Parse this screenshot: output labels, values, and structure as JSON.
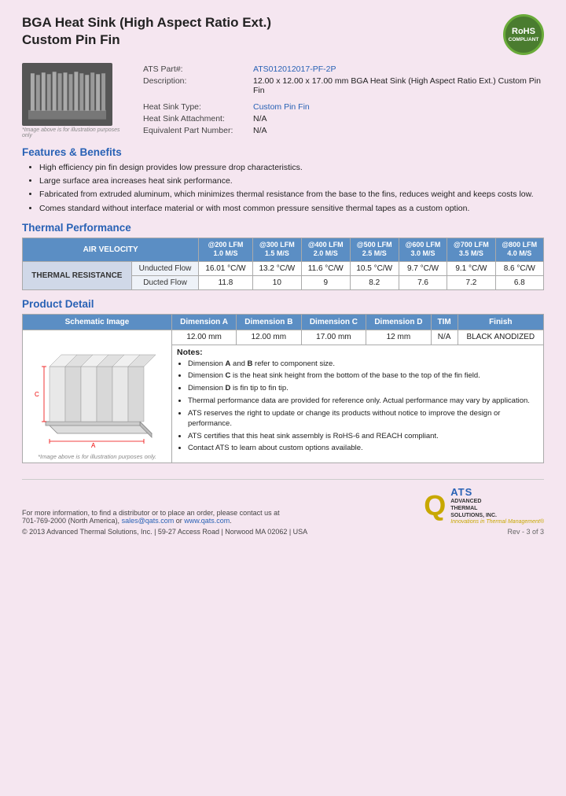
{
  "page": {
    "title_line1": "BGA Heat Sink (High Aspect Ratio Ext.)",
    "title_line2": "Custom Pin Fin",
    "rohs": {
      "line1": "RoHS",
      "line2": "COMPLIANT"
    },
    "part_label": "ATS Part#:",
    "part_number": "ATS012012017-PF-2P",
    "desc_label": "Description:",
    "description": "12.00 x 12.00 x 17.00 mm BGA Heat Sink (High Aspect Ratio Ext.) Custom Pin Fin",
    "hs_type_label": "Heat Sink Type:",
    "hs_type": "Custom Pin Fin",
    "hs_attach_label": "Heat Sink Attachment:",
    "hs_attach": "N/A",
    "equiv_part_label": "Equivalent Part Number:",
    "equiv_part": "N/A",
    "image_caption": "*Image above is for illustration purposes only",
    "features_title": "Features & Benefits",
    "features": [
      "High efficiency pin fin design provides low pressure drop characteristics.",
      "Large surface area increases heat sink performance.",
      "Fabricated from extruded aluminum, which minimizes thermal resistance from the base to the fins, reduces weight and keeps costs low.",
      "Comes standard without interface material or with most common pressure sensitive thermal tapes as a custom option."
    ],
    "thermal_title": "Thermal Performance",
    "air_velocity_label": "AIR VELOCITY",
    "thermal_resistance_label": "THERMAL RESISTANCE",
    "lfm_headers": [
      "@200 LFM\n1.0 M/S",
      "@300 LFM\n1.5 M/S",
      "@400 LFM\n2.0 M/S",
      "@500 LFM\n2.5 M/S",
      "@600 LFM\n3.0 M/S",
      "@700 LFM\n3.5 M/S",
      "@800 LFM\n4.0 M/S"
    ],
    "unducted_label": "Unducted Flow",
    "ducted_label": "Ducted Flow",
    "unducted_values": [
      "16.01 °C/W",
      "13.2 °C/W",
      "11.6 °C/W",
      "10.5 °C/W",
      "9.7 °C/W",
      "9.1 °C/W",
      "8.6 °C/W"
    ],
    "ducted_values": [
      "11.8",
      "10",
      "9",
      "8.2",
      "7.6",
      "7.2",
      "6.8"
    ],
    "product_detail_title": "Product Detail",
    "pd_headers": [
      "Schematic Image",
      "Dimension A",
      "Dimension B",
      "Dimension C",
      "Dimension D",
      "TIM",
      "Finish"
    ],
    "dim_a": "12.00 mm",
    "dim_b": "12.00 mm",
    "dim_c": "17.00 mm",
    "dim_d": "12 mm",
    "tim": "N/A",
    "finish": "BLACK ANODIZED",
    "schematic_caption": "*Image above is for illustration purposes only.",
    "notes_title": "Notes:",
    "notes": [
      "Dimension A and B refer to component size.",
      "Dimension C is the heat sink height from the bottom of the base to the top of the fin field.",
      "Dimension D is fin tip to fin tip.",
      "Thermal performance data are provided for reference only. Actual performance may vary by application.",
      "ATS reserves the right to update or change its products without notice to improve the design or performance.",
      "ATS certifies that this heat sink assembly is RoHS-6 and REACH compliant.",
      "Contact ATS to learn about custom options available."
    ],
    "footer_text": "For more information, to find a distributor or to place an order, please contact us at\n701-769-2000 (North America), sales@qats.com or www.qats.com.",
    "footer_email": "sales@qats.com",
    "footer_web": "www.qats.com",
    "copyright": "© 2013 Advanced Thermal Solutions, Inc. | 59-27 Access Road | Norwood MA  02062 | USA",
    "page_num": "Rev - 3 of 3",
    "ats_q": "Q",
    "ats_name": "ATS",
    "ats_fullname": "ADVANCED\nTHERMAL\nSOLUTIONS, INC.",
    "ats_tagline": "Innovations in Thermal Management®"
  }
}
